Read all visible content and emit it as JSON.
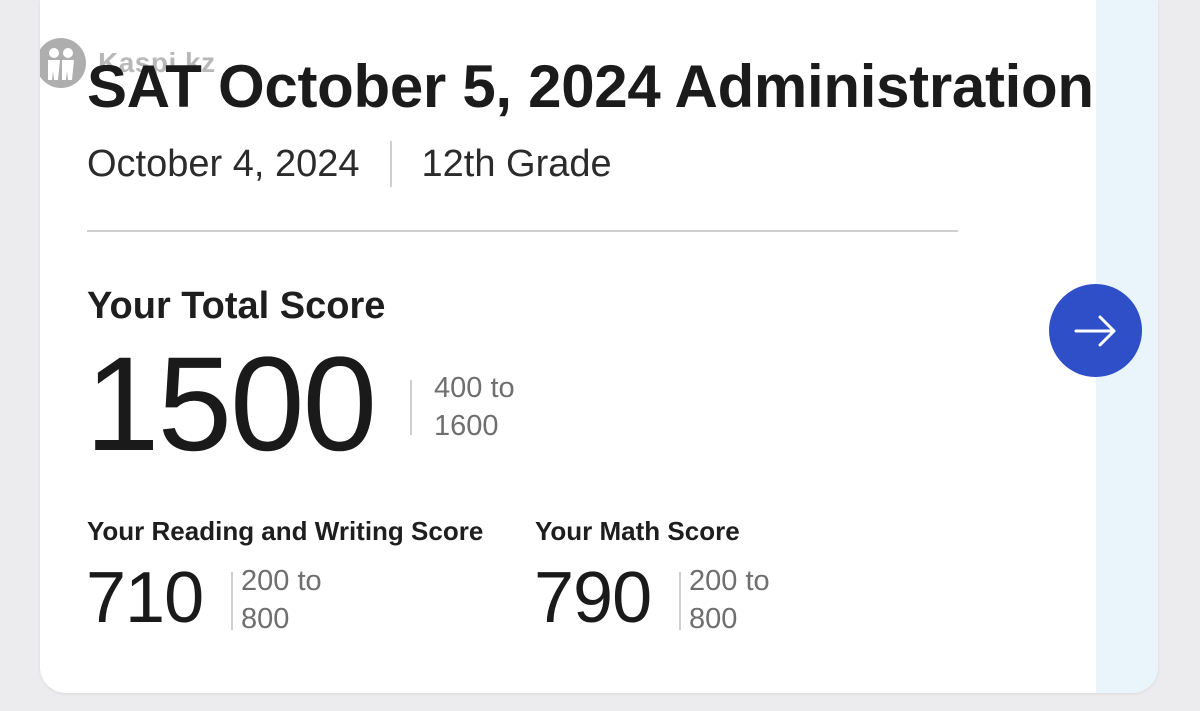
{
  "watermark": {
    "text": "Kaspi.kz"
  },
  "header": {
    "title": "SAT October 5, 2024 Administration",
    "date": "October 4, 2024",
    "grade": "12th Grade"
  },
  "total": {
    "label": "Your Total Score",
    "score": "1500",
    "range_line1": "400 to",
    "range_line2": "1600"
  },
  "reading_writing": {
    "label": "Your Reading and Writing Score",
    "score": "710",
    "range_line1": "200 to",
    "range_line2": "800"
  },
  "math": {
    "label": "Your Math Score",
    "score": "790",
    "range_line1": "200 to",
    "range_line2": "800"
  },
  "nav": {
    "next_icon": "arrow-right-icon"
  },
  "colors": {
    "accent": "#2f4fc9",
    "side_strip": "#e9f4fb",
    "muted_text": "#6f6f6f"
  }
}
